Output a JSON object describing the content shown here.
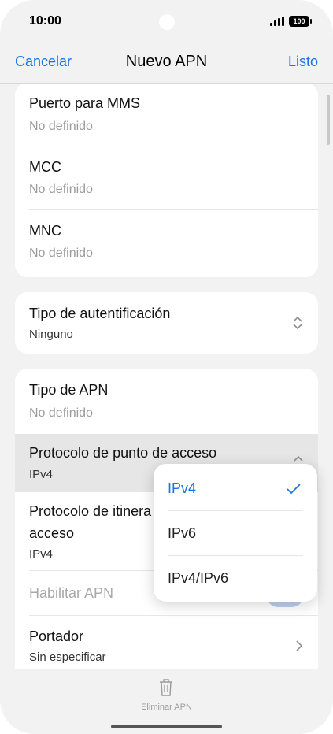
{
  "status": {
    "time": "10:00",
    "battery": "100"
  },
  "nav": {
    "cancel": "Cancelar",
    "title": "Nuevo APN",
    "done": "Listo"
  },
  "card1": {
    "rows": [
      {
        "label": "Puerto para MMS",
        "value": "No definido"
      },
      {
        "label": "MCC",
        "value": "No definido"
      },
      {
        "label": "MNC",
        "value": "No definido"
      }
    ]
  },
  "card2": {
    "label": "Tipo de autentificación",
    "value": "Ninguno"
  },
  "card3": {
    "apn_type": {
      "label": "Tipo de APN",
      "value": "No definido"
    },
    "protocol": {
      "label": "Protocolo de punto de acceso",
      "value": "IPv4"
    },
    "roaming": {
      "label_line1": "Protocolo de itinera",
      "label_line2": "acceso",
      "value": "IPv4"
    },
    "enable": {
      "label": "Habilitar APN"
    },
    "bearer": {
      "label": "Portador",
      "value": "Sin especificar"
    }
  },
  "popup": {
    "options": [
      "IPv4",
      "IPv6",
      "IPv4/IPv6"
    ],
    "selected": "IPv4"
  },
  "bottom": {
    "delete_label": "Eliminar APN"
  },
  "colors": {
    "accent": "#1a73e8",
    "background": "#f2f2f2"
  }
}
